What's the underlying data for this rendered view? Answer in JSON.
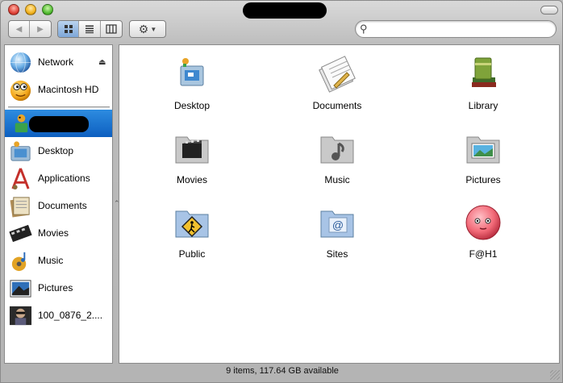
{
  "window": {
    "title": "",
    "status": "9 items, 117.64 GB available"
  },
  "toolbar": {
    "back_icon": "arrow-left-icon",
    "forward_icon": "arrow-right-icon",
    "views": [
      {
        "name": "icon-view",
        "active": true
      },
      {
        "name": "list-view",
        "active": false
      },
      {
        "name": "column-view",
        "active": false
      }
    ],
    "action_icon": "gear-icon",
    "search_value": ""
  },
  "sidebar": {
    "devices": [
      {
        "label": "Network",
        "icon": "network-globe-icon",
        "eject": true
      },
      {
        "label": "Macintosh HD",
        "icon": "hard-drive-icon",
        "eject": false
      }
    ],
    "places": [
      {
        "label": "",
        "icon": "home-folder-icon",
        "selected": true
      },
      {
        "label": "Desktop",
        "icon": "desktop-folder-icon"
      },
      {
        "label": "Applications",
        "icon": "applications-folder-icon"
      },
      {
        "label": "Documents",
        "icon": "documents-folder-icon"
      },
      {
        "label": "Movies",
        "icon": "movies-folder-icon"
      },
      {
        "label": "Music",
        "icon": "music-folder-icon"
      },
      {
        "label": "Pictures",
        "icon": "pictures-folder-icon"
      },
      {
        "label": "100_0876_2....",
        "icon": "photo-thumbnail-icon"
      }
    ]
  },
  "main": {
    "items": [
      {
        "label": "Desktop",
        "icon": "desktop-folder-icon"
      },
      {
        "label": "Documents",
        "icon": "documents-icon"
      },
      {
        "label": "Library",
        "icon": "library-books-icon"
      },
      {
        "label": "Movies",
        "icon": "movies-folder-icon"
      },
      {
        "label": "Music",
        "icon": "music-folder-icon"
      },
      {
        "label": "Pictures",
        "icon": "pictures-folder-icon"
      },
      {
        "label": "Public",
        "icon": "public-folder-icon"
      },
      {
        "label": "Sites",
        "icon": "sites-folder-icon"
      },
      {
        "label": "F@H1",
        "icon": "fah-ball-icon"
      }
    ]
  }
}
